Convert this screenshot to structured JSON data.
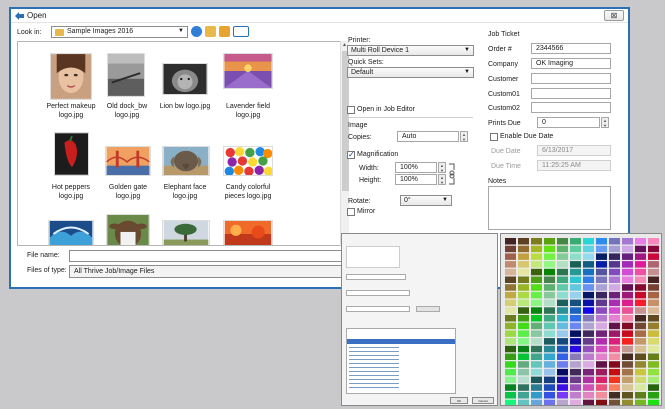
{
  "dialog": {
    "title": "Open",
    "close_glyph": "⊠"
  },
  "lookin": {
    "label": "Look in:",
    "value": "Sample Images 2016"
  },
  "files": [
    {
      "caption": "Perfect makeup logo.jpg"
    },
    {
      "caption": "Old dock_bw logo.jpg"
    },
    {
      "caption": "Lion bw logo.jpg"
    },
    {
      "caption": "Lavender field logo.jpg"
    },
    {
      "caption": "Hot peppers logo.jpg"
    },
    {
      "caption": "Golden gate logo.jpg"
    },
    {
      "caption": "Elephant face logo.jpg"
    },
    {
      "caption": "Candy colorful pieces logo.jpg"
    }
  ],
  "filename": {
    "label": "File name:",
    "value": ""
  },
  "filetype": {
    "label": "Files of type:",
    "value": "All Thrive Job/Image Files"
  },
  "printer": {
    "label": "Printer:",
    "value": "Multi Roll Device 1",
    "quicksets_label": "Quick Sets:",
    "quicksets_value": "Default",
    "open_in_editor": "Open in Job Editor"
  },
  "image": {
    "label": "Image",
    "copies_label": "Copies:",
    "copies_value": "Auto",
    "magnification_label": "Magnification",
    "width_label": "Width:",
    "width_value": "100%",
    "height_label": "Height:",
    "height_value": "100%",
    "rotate_label": "Rotate:",
    "rotate_value": "0°",
    "mirror_label": "Mirror"
  },
  "ticket": {
    "label": "Job Ticket",
    "order_label": "Order #",
    "order_value": "2344566",
    "company_label": "Company",
    "company_value": "OK Imaging",
    "customer_label": "Customer",
    "custom01_label": "Custom01",
    "custom02_label": "Custom02",
    "prints_due_label": "Prints Due",
    "prints_due_value": "0",
    "enable_due_label": "Enable Due Date",
    "due_date_label": "Due Date",
    "due_date_value": "6/13/2017",
    "due_time_label": "Due Time",
    "due_time_value": "11:25:25 AM",
    "notes_label": "Notes"
  },
  "preview_dialog": {
    "ok": "OK",
    "cancel": "Cancel"
  },
  "colors": {
    "window_border": "#2b6fb5",
    "background": "#c9c9cb",
    "folder": "#e8b84a"
  }
}
